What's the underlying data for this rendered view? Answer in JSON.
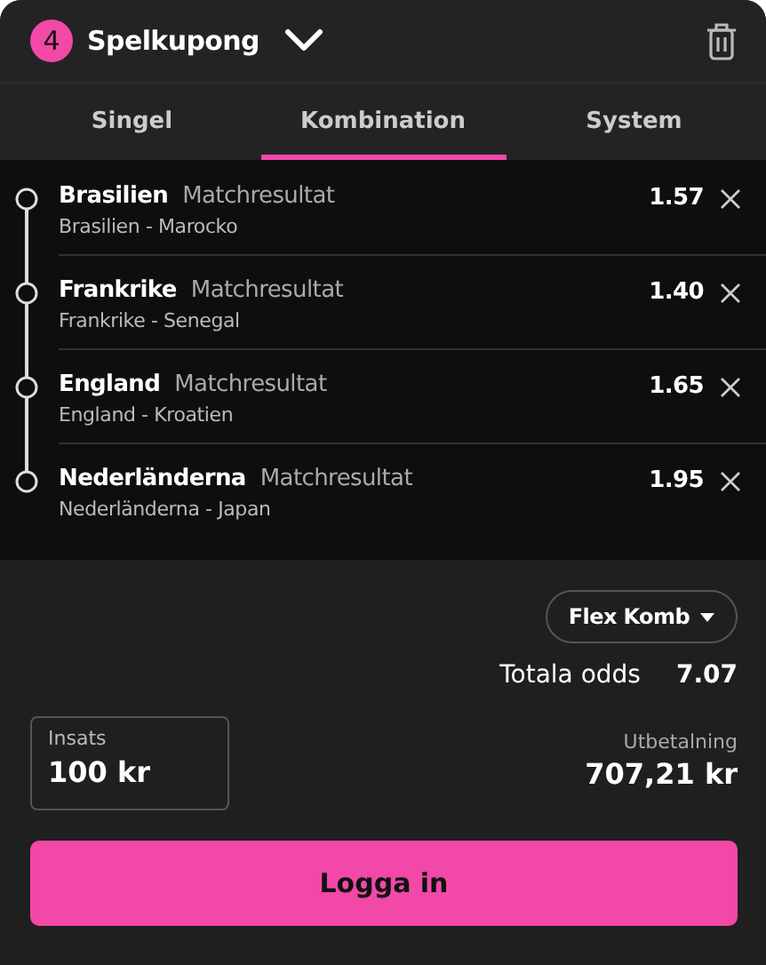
{
  "header": {
    "count": "4",
    "title": "Spelkupong"
  },
  "tabs": [
    {
      "label": "Singel",
      "selected": false
    },
    {
      "label": "Kombination",
      "selected": true
    },
    {
      "label": "System",
      "selected": false
    }
  ],
  "selections": [
    {
      "pick": "Brasilien",
      "market": "Matchresultat",
      "match": "Brasilien - Marocko",
      "odds": "1.57"
    },
    {
      "pick": "Frankrike",
      "market": "Matchresultat",
      "match": "Frankrike - Senegal",
      "odds": "1.40"
    },
    {
      "pick": "England",
      "market": "Matchresultat",
      "match": "England - Kroatien",
      "odds": "1.65"
    },
    {
      "pick": "Nederländerna",
      "market": "Matchresultat",
      "match": "Nederländerna - Japan",
      "odds": "1.95"
    }
  ],
  "bet_type": "Flex Komb",
  "total_odds": {
    "label": "Totala odds",
    "value": "7.07"
  },
  "stake": {
    "label": "Insats",
    "value": "100 kr"
  },
  "payout": {
    "label": "Utbetalning",
    "value": "707,21 kr"
  },
  "login_button": "Logga in"
}
